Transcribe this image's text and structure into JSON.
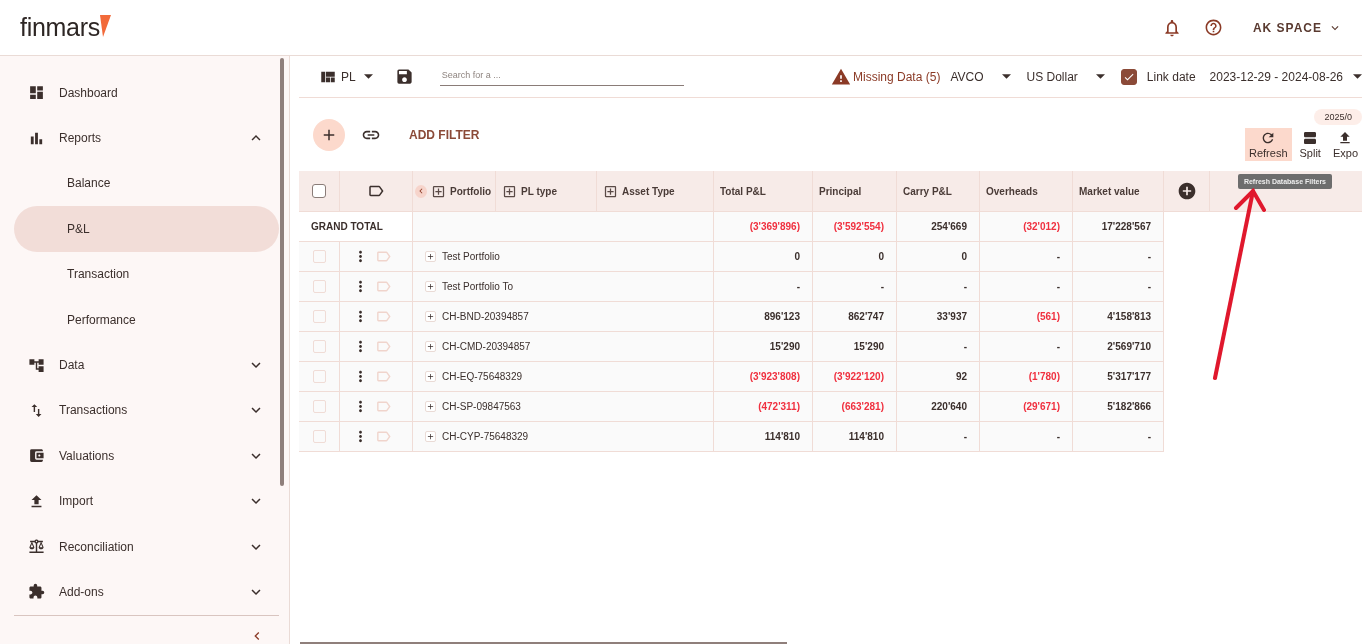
{
  "header": {
    "logo": "finmars",
    "account": "AK SPACE"
  },
  "sidebar": {
    "items": [
      {
        "label": "Dashboard",
        "kind": "link"
      },
      {
        "label": "Reports",
        "kind": "group",
        "expanded": true,
        "children": [
          {
            "label": "Balance",
            "selected": false
          },
          {
            "label": "P&L",
            "selected": true
          },
          {
            "label": "Transaction",
            "selected": false
          },
          {
            "label": "Performance",
            "selected": false
          }
        ]
      },
      {
        "label": "Data",
        "kind": "group",
        "expanded": false
      },
      {
        "label": "Transactions",
        "kind": "group",
        "expanded": false
      },
      {
        "label": "Valuations",
        "kind": "group",
        "expanded": false
      },
      {
        "label": "Import",
        "kind": "group",
        "expanded": false
      },
      {
        "label": "Reconciliation",
        "kind": "group",
        "expanded": false
      },
      {
        "label": "Add-ons",
        "kind": "group",
        "expanded": false
      }
    ]
  },
  "toolbar": {
    "layout": "PL",
    "search_placeholder": "Search for a ...",
    "missing_data": "Missing Data (5)",
    "cost_method": "AVCO",
    "currency": "US Dollar",
    "link_date": {
      "label": "Link date",
      "checked": true
    },
    "date_range": "2023-12-29 - 2024-08-26"
  },
  "filter_bar": {
    "add_filter": "ADD FILTER",
    "date_chip": "2025/0",
    "actions": [
      {
        "label": "Refresh",
        "selected": true
      },
      {
        "label": "Split",
        "selected": false
      },
      {
        "label": "Expo",
        "selected": false
      }
    ],
    "tooltip": "Refresh Database Filters"
  },
  "table": {
    "select_all": {
      "checked": false
    },
    "columns": [
      {
        "label": "Portfolio",
        "kind": "group"
      },
      {
        "label": "PL type",
        "kind": "group"
      },
      {
        "label": "Asset Type",
        "kind": "group"
      },
      {
        "label": "Total P&L",
        "kind": "value"
      },
      {
        "label": "Principal",
        "kind": "value"
      },
      {
        "label": "Carry P&L",
        "kind": "value"
      },
      {
        "label": "Overheads",
        "kind": "value"
      },
      {
        "label": "Market value",
        "kind": "value"
      }
    ],
    "grand_total": {
      "label": "GRAND TOTAL",
      "values": [
        {
          "text": "(3'369'896)",
          "negative": true
        },
        {
          "text": "(3'592'554)",
          "negative": true
        },
        {
          "text": "254'669",
          "negative": false
        },
        {
          "text": "(32'012)",
          "negative": true
        },
        {
          "text": "17'228'567",
          "negative": false
        }
      ]
    },
    "rows": [
      {
        "name": "Test Portfolio",
        "checked": false,
        "values": [
          {
            "text": "0",
            "negative": false
          },
          {
            "text": "0",
            "negative": false
          },
          {
            "text": "0",
            "negative": false
          },
          {
            "text": "-",
            "negative": false
          },
          {
            "text": "-",
            "negative": false
          }
        ]
      },
      {
        "name": "Test Portfolio To",
        "checked": false,
        "values": [
          {
            "text": "-",
            "negative": false
          },
          {
            "text": "-",
            "negative": false
          },
          {
            "text": "-",
            "negative": false
          },
          {
            "text": "-",
            "negative": false
          },
          {
            "text": "-",
            "negative": false
          }
        ]
      },
      {
        "name": "CH-BND-20394857",
        "checked": false,
        "values": [
          {
            "text": "896'123",
            "negative": false
          },
          {
            "text": "862'747",
            "negative": false
          },
          {
            "text": "33'937",
            "negative": false
          },
          {
            "text": "(561)",
            "negative": true
          },
          {
            "text": "4'158'813",
            "negative": false
          }
        ]
      },
      {
        "name": "CH-CMD-20394857",
        "checked": false,
        "values": [
          {
            "text": "15'290",
            "negative": false
          },
          {
            "text": "15'290",
            "negative": false
          },
          {
            "text": "-",
            "negative": false
          },
          {
            "text": "-",
            "negative": false
          },
          {
            "text": "2'569'710",
            "negative": false
          }
        ]
      },
      {
        "name": "CH-EQ-75648329",
        "checked": false,
        "values": [
          {
            "text": "(3'923'808)",
            "negative": true
          },
          {
            "text": "(3'922'120)",
            "negative": true
          },
          {
            "text": "92",
            "negative": false
          },
          {
            "text": "(1'780)",
            "negative": true
          },
          {
            "text": "5'317'177",
            "negative": false
          }
        ]
      },
      {
        "name": "CH-SP-09847563",
        "checked": false,
        "values": [
          {
            "text": "(472'311)",
            "negative": true
          },
          {
            "text": "(663'281)",
            "negative": true
          },
          {
            "text": "220'640",
            "negative": false
          },
          {
            "text": "(29'671)",
            "negative": true
          },
          {
            "text": "5'182'866",
            "negative": false
          }
        ]
      },
      {
        "name": "CH-CYP-75648329",
        "checked": false,
        "values": [
          {
            "text": "114'810",
            "negative": false
          },
          {
            "text": "114'810",
            "negative": false
          },
          {
            "text": "-",
            "negative": false
          },
          {
            "text": "-",
            "negative": false
          },
          {
            "text": "-",
            "negative": false
          }
        ]
      }
    ]
  }
}
